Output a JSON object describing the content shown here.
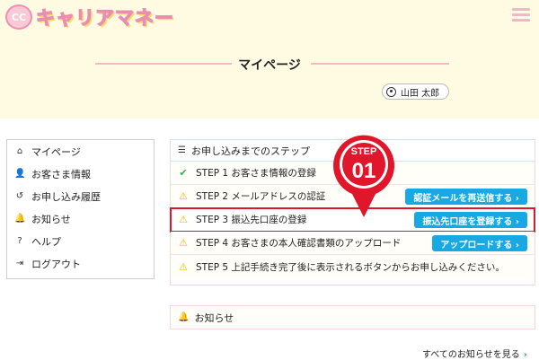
{
  "header": {
    "logo_mark": "CC",
    "logo_text": "キャリアマネー",
    "menu_icon": "hamburger-icon"
  },
  "page": {
    "title": "マイページ",
    "user_name": "山田 太郎"
  },
  "sidebar": {
    "items": [
      {
        "label": "マイページ",
        "icon": "home-icon"
      },
      {
        "label": "お客さま情報",
        "icon": "user-icon"
      },
      {
        "label": "お申し込み履歴",
        "icon": "history-icon"
      },
      {
        "label": "お知らせ",
        "icon": "bell-icon"
      },
      {
        "label": "ヘルプ",
        "icon": "help-icon"
      },
      {
        "label": "ログアウト",
        "icon": "logout-icon"
      }
    ]
  },
  "steps": {
    "heading": "お申し込みまでのステップ",
    "items": [
      {
        "status": "done",
        "label": "STEP 1 お客さま情報の登録"
      },
      {
        "status": "pending",
        "label": "STEP 2 メールアドレスの認証",
        "button": "認証メールを再送信する ›"
      },
      {
        "status": "pending",
        "label": "STEP 3 振込先口座の登録",
        "button": "振込先口座を登録する ›"
      },
      {
        "status": "pending",
        "label": "STEP 4 お客さまの本人確認書類のアップロード",
        "button": "アップロードする ›"
      },
      {
        "status": "pending",
        "label": "STEP 5 上記手続き完了後に表示されるボタンからお申し込みください。"
      }
    ]
  },
  "marker": {
    "word": "STEP",
    "number": "01"
  },
  "notices": {
    "heading": "お知らせ",
    "all_link": "すべてのお知らせを見る",
    "all_link_chevron": "›"
  },
  "colors": {
    "accent_blue": "#18a8e4",
    "highlight_red": "#e0162b",
    "header_bg": "#fffbe3",
    "pink": "#f0b9d0"
  }
}
